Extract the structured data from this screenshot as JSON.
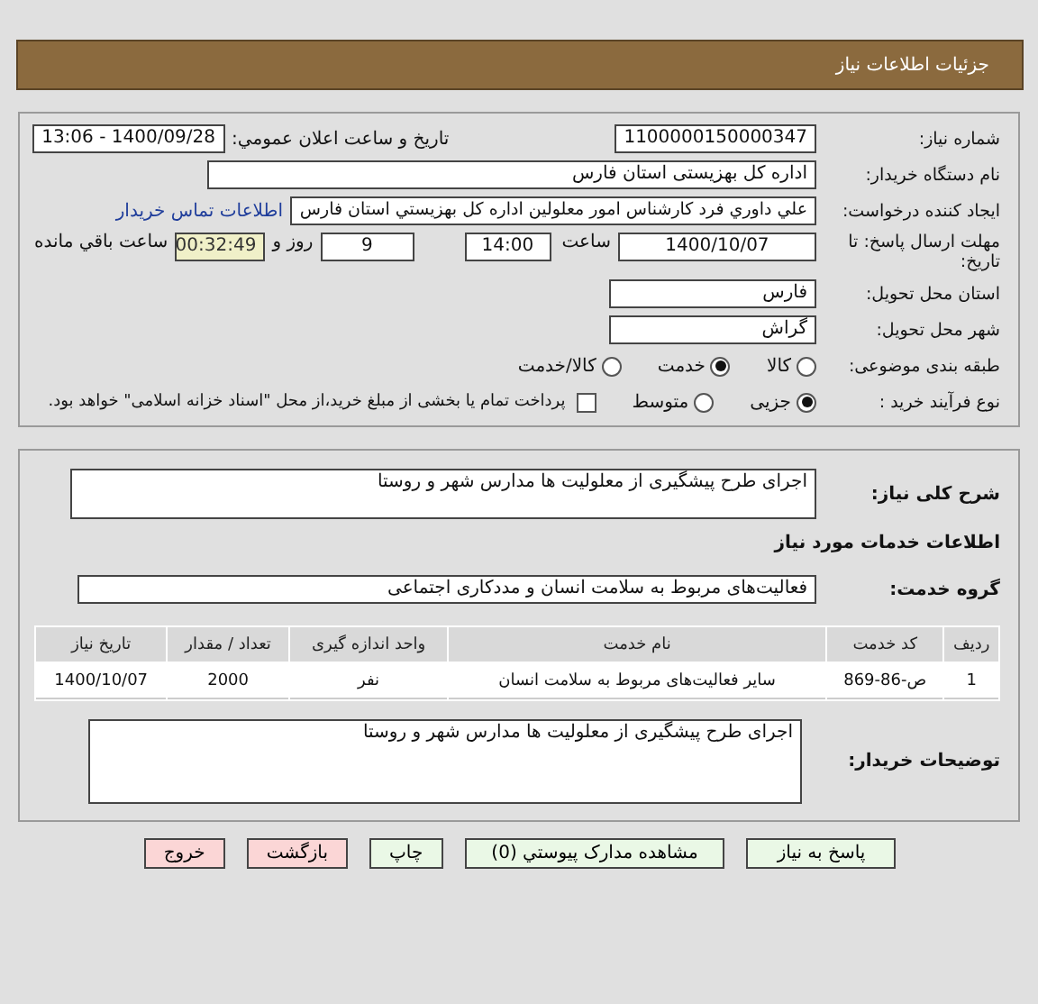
{
  "header": {
    "title": "جزئیات اطلاعات نیاز"
  },
  "need_number": {
    "label": "شماره نیاز:",
    "value": "1100000150000347"
  },
  "announce": {
    "label": "تاريخ و ساعت اعلان عمومي:",
    "value": "1400/09/28 - 13:06"
  },
  "buyer": {
    "label": "نام دستگاه خريدار:",
    "value": "اداره کل بهزیستی استان فارس"
  },
  "creator": {
    "label": "ایجاد کننده درخواست:",
    "value": "علي داوري فرد كارشناس امور معلولين اداره كل بهزيستي استان فارس",
    "link": "اطلاعات تماس خريدار"
  },
  "deadline": {
    "label": "مهلت ارسال پاسخ: تا تاریخ:",
    "date": "1400/10/07",
    "time_label": "ساعت",
    "time": "14:00",
    "days": "9",
    "days_label": "روز و",
    "remaining": "00:32:49",
    "remaining_label": "ساعت باقي مانده"
  },
  "province": {
    "label": "استان محل تحویل:",
    "value": "فارس"
  },
  "city": {
    "label": "شهر محل تحویل:",
    "value": "گراش"
  },
  "category": {
    "label": "طبقه بندی موضوعی:",
    "options": [
      {
        "label": "كالا",
        "selected": false
      },
      {
        "label": "خدمت",
        "selected": true
      },
      {
        "label": "كالا/خدمت",
        "selected": false
      }
    ]
  },
  "process": {
    "label": "نوع فرآیند خرید :",
    "options": [
      {
        "label": "جزیی",
        "selected": true
      },
      {
        "label": "متوسط",
        "selected": false
      }
    ],
    "treasury": {
      "label": "پرداخت تمام یا بخشی از مبلغ خرید،از محل \"اسناد خزانه اسلامی\" خواهد بود.",
      "checked": false
    }
  },
  "description": {
    "label": "شرح کلی نیاز:",
    "value": "اجرای طرح پیشگیری از معلولیت ها مدارس شهر و روستا"
  },
  "services_heading": "اطلاعات خدمات مورد نیاز",
  "service_group": {
    "label": "گروه خدمت:",
    "value": "فعالیت‌های مربوط به سلامت انسان و مددکاری اجتماعی"
  },
  "table": {
    "columns": [
      "ردیف",
      "کد خدمت",
      "نام خدمت",
      "واحد اندازه گیری",
      "تعداد / مقدار",
      "تاریخ نیاز"
    ],
    "rows": [
      [
        "1",
        "ص-86-869",
        "سایر فعالیت‌های مربوط به سلامت انسان",
        "نفر",
        "2000",
        "1400/10/07"
      ]
    ]
  },
  "buyer_notes": {
    "label": "توضیحات خریدار:",
    "value": "اجرای طرح پیشگیری از معلولیت ها مدارس شهر و روستا"
  },
  "buttons": [
    {
      "label": "پاسخ به نیاز",
      "kind": "action"
    },
    {
      "label": "مشاهده مدارک پیوستي (0)",
      "kind": "action"
    },
    {
      "label": "چاپ",
      "kind": "action"
    },
    {
      "label": "بازگشت",
      "kind": "exit"
    },
    {
      "label": "خروج",
      "kind": "exit"
    }
  ]
}
